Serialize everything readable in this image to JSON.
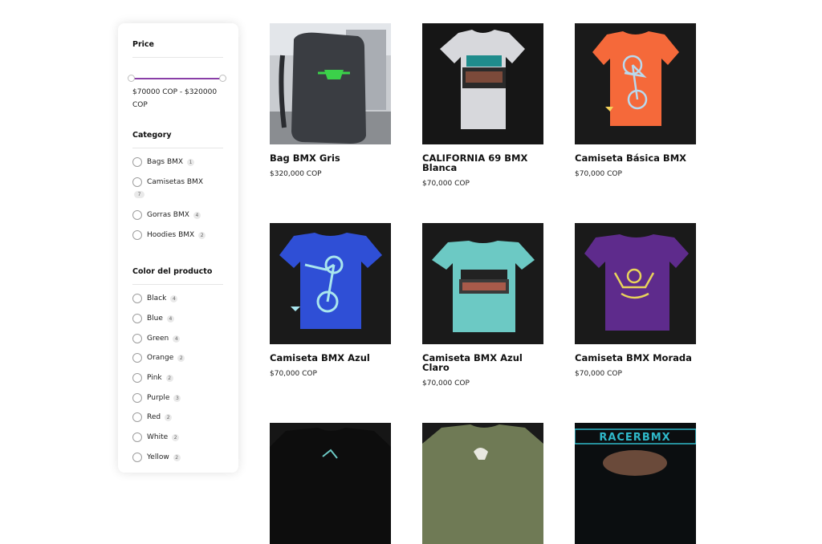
{
  "filters": {
    "price": {
      "title": "Price",
      "range_text": "$70000 COP - $320000 COP",
      "min_value": 70000,
      "max_value": 320000
    },
    "category": {
      "title": "Category",
      "items": [
        {
          "label": "Bags BMX",
          "count": "1"
        },
        {
          "label": "Camisetas BMX",
          "count": "7"
        },
        {
          "label": "Gorras BMX",
          "count": "4"
        },
        {
          "label": "Hoodies BMX",
          "count": "2"
        }
      ]
    },
    "color": {
      "title": "Color del producto",
      "items": [
        {
          "label": "Black",
          "count": "4"
        },
        {
          "label": "Blue",
          "count": "4"
        },
        {
          "label": "Green",
          "count": "4"
        },
        {
          "label": "Orange",
          "count": "2"
        },
        {
          "label": "Pink",
          "count": "2"
        },
        {
          "label": "Purple",
          "count": "3"
        },
        {
          "label": "Red",
          "count": "2"
        },
        {
          "label": "White",
          "count": "2"
        },
        {
          "label": "Yellow",
          "count": "2"
        }
      ]
    }
  },
  "products": [
    {
      "name": "Bag BMX Gris",
      "price": "$320,000 COP",
      "image": "gray-backpack"
    },
    {
      "name": "CALIFORNIA 69 BMX Blanca",
      "price": "$70,000 COP",
      "image": "white-tshirt"
    },
    {
      "name": "Camiseta Básica BMX",
      "price": "$70,000 COP",
      "image": "orange-tshirt"
    },
    {
      "name": "Camiseta BMX Azul",
      "price": "$70,000 COP",
      "image": "blue-tshirt"
    },
    {
      "name": "Camiseta BMX Azul Claro",
      "price": "$70,000 COP",
      "image": "light-blue-tshirt"
    },
    {
      "name": "Camiseta BMX Morada",
      "price": "$70,000 COP",
      "image": "purple-tshirt"
    },
    {
      "name": "",
      "price": "",
      "image": "black-tshirt"
    },
    {
      "name": "",
      "price": "",
      "image": "olive-tshirt"
    },
    {
      "name": "",
      "price": "",
      "image": "racer-bmx-cap",
      "logo_text": "RACERBMX"
    }
  ],
  "colors": {
    "accent": "#8a3fa8",
    "gray_bag": "#3a3d42",
    "white_shirt": "#d7d8dc",
    "orange_shirt": "#f5693a",
    "blue_shirt": "#2f4fd6",
    "light_blue_shirt": "#6cc9c4",
    "purple_shirt": "#5e2b8c",
    "olive_shirt": "#6f7a55"
  }
}
